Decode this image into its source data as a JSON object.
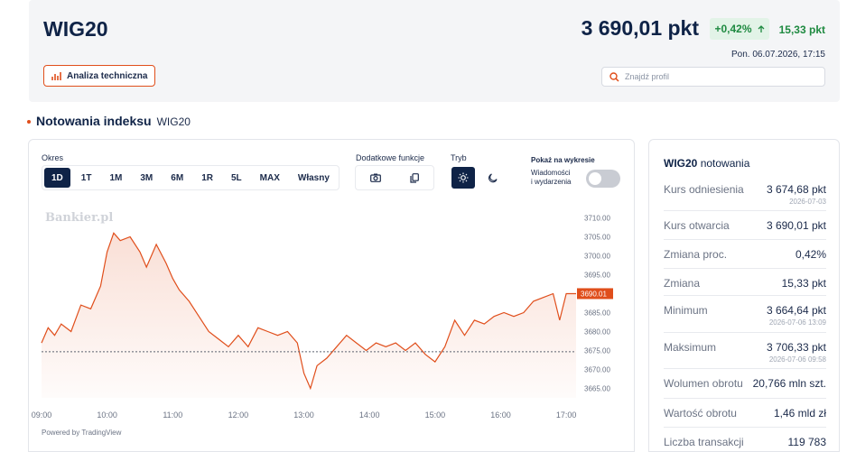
{
  "header": {
    "ticker": "WIG20",
    "price": "3 690,01 pkt",
    "change_pct": "+0,42%",
    "change_abs": "15,33 pkt",
    "datetime": "Pon. 06.07.2026, 17:15",
    "ta_button": "Analiza techniczna",
    "search_placeholder": "Znajdź profil",
    "colors": {
      "positive": "#1f8a41",
      "accent": "#e04e1b",
      "navy": "#0f2347"
    }
  },
  "section": {
    "title": "Notowania indeksu",
    "subtitle": "WIG20"
  },
  "controls": {
    "period_label": "Okres",
    "periods": [
      "1D",
      "1T",
      "1M",
      "3M",
      "6M",
      "1R",
      "5L",
      "MAX",
      "Własny"
    ],
    "active_period": "1D",
    "tools_label": "Dodatkowe funkcje",
    "tools": [
      "camera-icon",
      "copy-icon"
    ],
    "mode_label": "Tryb",
    "modes": [
      "sun-icon",
      "moon-icon"
    ],
    "show_label": "Pokaż na wykresie",
    "news_label_1": "Wiadomości",
    "news_label_2": "i wydarzenia",
    "news_toggle_on": false
  },
  "chart_data": {
    "type": "area",
    "watermark": "Bankier.pl",
    "x_ticks": [
      "09:00",
      "10:00",
      "11:00",
      "12:00",
      "13:00",
      "14:00",
      "15:00",
      "16:00",
      "17:00"
    ],
    "y_ticks": [
      "3710.00",
      "3705.00",
      "3700.00",
      "3695.00",
      "3690.00",
      "3685.00",
      "3680.00",
      "3675.00",
      "3670.00",
      "3665.00"
    ],
    "ylim": [
      3662.5,
      3712.5
    ],
    "reference_value": 3674.68,
    "last_label": "3690.01",
    "line_color": "#e04e1b",
    "x": [
      9.0,
      9.1,
      9.2,
      9.3,
      9.45,
      9.6,
      9.75,
      9.9,
      10.0,
      10.1,
      10.2,
      10.35,
      10.5,
      10.6,
      10.75,
      10.9,
      11.0,
      11.1,
      11.25,
      11.4,
      11.55,
      11.7,
      11.85,
      12.0,
      12.15,
      12.3,
      12.45,
      12.6,
      12.75,
      12.9,
      13.0,
      13.1,
      13.2,
      13.35,
      13.5,
      13.65,
      13.8,
      13.95,
      14.1,
      14.25,
      14.4,
      14.55,
      14.7,
      14.85,
      15.0,
      15.15,
      15.3,
      15.45,
      15.6,
      15.75,
      15.9,
      16.05,
      16.2,
      16.35,
      16.5,
      16.65,
      16.8,
      16.9,
      17.0,
      17.15
    ],
    "y": [
      3677,
      3681,
      3679,
      3682,
      3680,
      3687,
      3686,
      3692,
      3701,
      3706,
      3704,
      3705,
      3701,
      3697,
      3703,
      3698,
      3694,
      3691,
      3688,
      3684,
      3680,
      3678,
      3676,
      3679,
      3676,
      3681,
      3680,
      3679,
      3680,
      3677,
      3669,
      3665,
      3671,
      3673,
      3676,
      3679,
      3677,
      3675,
      3677,
      3676,
      3677,
      3675,
      3677,
      3674,
      3672,
      3676,
      3683,
      3679,
      3683,
      3682,
      3684,
      3685,
      3684,
      3685,
      3688,
      3689,
      3690,
      3683,
      3690,
      3690.01
    ],
    "xlabel": "",
    "ylabel": ""
  },
  "chart_footer": "Powered by TradingView",
  "side": {
    "title_bold": "WIG20",
    "title_rest": "notowania",
    "rows": [
      {
        "label": "Kurs odniesienia",
        "value": "3 674,68 pkt",
        "sub": "2026-07-03"
      },
      {
        "label": "Kurs otwarcia",
        "value": "3 690,01 pkt",
        "sub": ""
      },
      {
        "label": "Zmiana proc.",
        "value": "0,42%",
        "sub": ""
      },
      {
        "label": "Zmiana",
        "value": "15,33 pkt",
        "sub": ""
      },
      {
        "label": "Minimum",
        "value": "3 664,64 pkt",
        "sub": "2026-07-06 13:09"
      },
      {
        "label": "Maksimum",
        "value": "3 706,33 pkt",
        "sub": "2026-07-06 09:58"
      },
      {
        "label": "Wolumen obrotu",
        "value": "20,766 mln szt.",
        "sub": ""
      },
      {
        "label": "Wartość obrotu",
        "value": "1,46 mld zł",
        "sub": ""
      },
      {
        "label": "Liczba transakcji",
        "value": "119 783",
        "sub": ""
      }
    ]
  }
}
